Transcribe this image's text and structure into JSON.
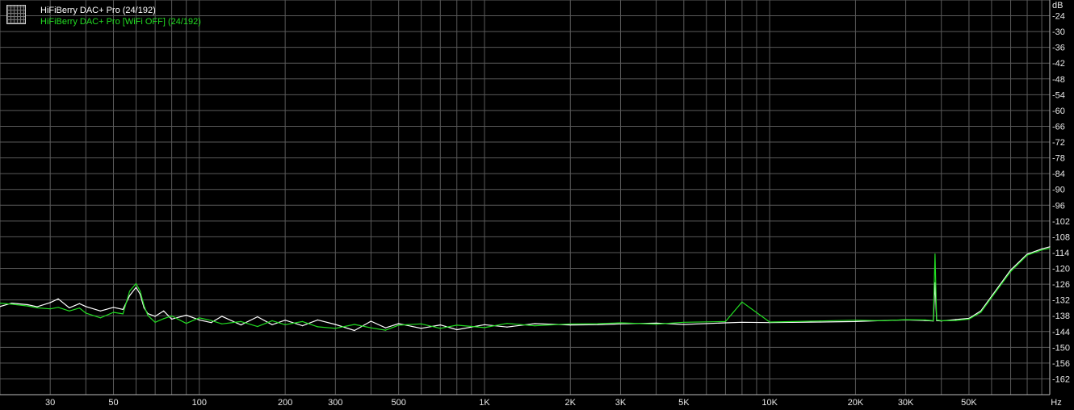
{
  "legend": {
    "items": [
      {
        "label": "HiFiBerry DAC+ Pro (24/192)",
        "color": "#ffffff"
      },
      {
        "label": "HiFiBerry DAC+ Pro [WiFi OFF] (24/192)",
        "color": "#22dd22"
      }
    ]
  },
  "chart_data": {
    "type": "line",
    "title": "",
    "xlabel": "Hz",
    "ylabel": "dB",
    "x_scale": "log",
    "xlim": [
      20,
      96000
    ],
    "ylim": [
      -162,
      -18
    ],
    "grid": true,
    "background": "#000000",
    "grid_color": "#5a5a5a",
    "y_ticks": [
      "dB",
      "-24",
      "-30",
      "-36",
      "-42",
      "-48",
      "-54",
      "-60",
      "-66",
      "-72",
      "-78",
      "-84",
      "-90",
      "-96",
      "-102",
      "-108",
      "-114",
      "-120",
      "-126",
      "-132",
      "-138",
      "-144",
      "-150",
      "-156",
      "-162"
    ],
    "x_ticks": [
      {
        "value": 30,
        "label": "30"
      },
      {
        "value": 50,
        "label": "50"
      },
      {
        "value": 100,
        "label": "100"
      },
      {
        "value": 200,
        "label": "200"
      },
      {
        "value": 300,
        "label": "300"
      },
      {
        "value": 500,
        "label": "500"
      },
      {
        "value": 1000,
        "label": "1K"
      },
      {
        "value": 2000,
        "label": "2K"
      },
      {
        "value": 3000,
        "label": "3K"
      },
      {
        "value": 5000,
        "label": "5K"
      },
      {
        "value": 10000,
        "label": "10K"
      },
      {
        "value": 20000,
        "label": "20K"
      },
      {
        "value": 30000,
        "label": "30K"
      },
      {
        "value": 50000,
        "label": "50K"
      },
      {
        "value": 96000,
        "label": "Hz"
      }
    ],
    "series": [
      {
        "name": "HiFiBerry DAC+ Pro (24/192)",
        "color": "#ffffff",
        "x": [
          20,
          22,
          25,
          27,
          30,
          32,
          35,
          38,
          40,
          45,
          50,
          54,
          57,
          60,
          62,
          64,
          66,
          70,
          75,
          80,
          90,
          100,
          110,
          120,
          140,
          160,
          180,
          200,
          230,
          260,
          300,
          350,
          400,
          450,
          500,
          600,
          700,
          800,
          1000,
          1200,
          1500,
          2000,
          2500,
          3000,
          4000,
          5000,
          7000,
          8000,
          10000,
          15000,
          20000,
          25000,
          30000,
          35000,
          37500,
          38000,
          38500,
          40000,
          45000,
          50000,
          55000,
          60000,
          70000,
          80000,
          90000,
          96000
        ],
        "y": [
          -134.5,
          -133.2,
          -133.8,
          -134.6,
          -133.0,
          -131.6,
          -135.0,
          -133.4,
          -134.5,
          -136.2,
          -134.8,
          -135.6,
          -130.3,
          -127.2,
          -129.8,
          -135.0,
          -137.2,
          -138.2,
          -136.2,
          -139.3,
          -137.8,
          -139.6,
          -140.6,
          -138.2,
          -141.5,
          -138.4,
          -141.4,
          -139.7,
          -141.8,
          -139.6,
          -141.3,
          -143.6,
          -140.1,
          -142.6,
          -141.0,
          -142.8,
          -141.5,
          -143.3,
          -141.4,
          -142.3,
          -141.0,
          -141.5,
          -141.4,
          -141.1,
          -140.8,
          -141.3,
          -140.7,
          -140.5,
          -140.6,
          -140.4,
          -140.2,
          -139.8,
          -139.6,
          -139.8,
          -140.0,
          -125.5,
          -139.8,
          -140.0,
          -139.4,
          -139.0,
          -136.2,
          -130.6,
          -120.6,
          -114.6,
          -112.6,
          -111.8
        ]
      },
      {
        "name": "HiFiBerry DAC+ Pro [WiFi OFF] (24/192)",
        "color": "#22dd22",
        "x": [
          20,
          22,
          25,
          27,
          30,
          32,
          35,
          38,
          40,
          45,
          50,
          54,
          57,
          60,
          62,
          64,
          66,
          70,
          75,
          80,
          90,
          100,
          110,
          120,
          140,
          160,
          180,
          200,
          230,
          260,
          300,
          350,
          400,
          450,
          500,
          600,
          700,
          800,
          1000,
          1200,
          1500,
          2000,
          2500,
          3000,
          4000,
          5000,
          7000,
          8000,
          10000,
          15000,
          20000,
          25000,
          30000,
          35000,
          37500,
          38000,
          38500,
          40000,
          45000,
          50000,
          55000,
          60000,
          70000,
          80000,
          90000,
          96000
        ],
        "y": [
          -133.2,
          -133.6,
          -134.3,
          -135.0,
          -135.4,
          -134.8,
          -136.2,
          -135.1,
          -137.0,
          -138.8,
          -136.7,
          -137.3,
          -128.6,
          -125.8,
          -128.6,
          -134.2,
          -137.9,
          -140.5,
          -139.1,
          -138.1,
          -140.9,
          -138.8,
          -139.8,
          -141.1,
          -140.2,
          -142.1,
          -139.9,
          -141.4,
          -140.2,
          -142.2,
          -142.8,
          -141.3,
          -142.6,
          -143.5,
          -141.6,
          -141.1,
          -142.8,
          -141.6,
          -142.5,
          -140.9,
          -141.8,
          -141.1,
          -141.0,
          -140.7,
          -141.2,
          -140.5,
          -140.2,
          -132.8,
          -140.4,
          -140.0,
          -139.7,
          -139.9,
          -139.5,
          -139.6,
          -139.9,
          -114.6,
          -139.6,
          -139.9,
          -139.8,
          -139.3,
          -136.7,
          -131.1,
          -121.2,
          -115.0,
          -113.0,
          -112.4
        ]
      }
    ]
  }
}
